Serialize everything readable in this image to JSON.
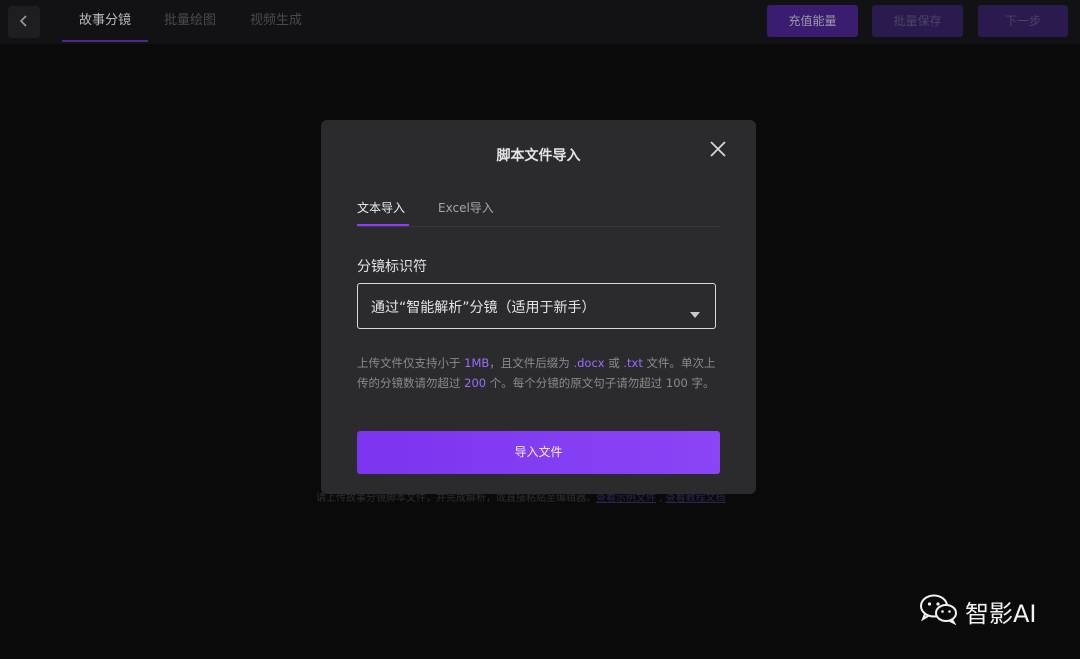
{
  "topbar": {
    "tabs": [
      {
        "label": "故事分镜",
        "active": true
      },
      {
        "label": "批量绘图",
        "active": false
      },
      {
        "label": "视频生成",
        "active": false
      }
    ],
    "buttons": {
      "recharge": "充值能量",
      "middle": "批量保存",
      "next": "下一步"
    }
  },
  "background_hint": {
    "text": "请上传故事分镜脚本文件，并完成解析，或直接粘贴至编辑器。",
    "link1": "查看示例文件",
    "link2": "查看教程文档"
  },
  "modal": {
    "title": "脚本文件导入",
    "tabs": [
      {
        "label": "文本导入",
        "active": true
      },
      {
        "label": "Excel导入",
        "active": false
      }
    ],
    "field_label": "分镜标识符",
    "select_value": "通过“智能解析”分镜（适用于新手）",
    "info": {
      "p1": "上传文件仅支持小于 ",
      "size": "1MB",
      "p2": "，且文件后缀为 ",
      "ext1": ".docx",
      "p3": " 或 ",
      "ext2": ".txt",
      "p4": " 文件。单次上传的分镜数请勿超过 ",
      "count": "200",
      "p5": " 个。每个分镜的原文句子请勿超过 100 字。"
    },
    "import_button": "导入文件"
  },
  "watermark": {
    "text": "智影AI"
  },
  "colors": {
    "accent": "#7c3aed",
    "highlight": "#9b6bff",
    "modal_bg": "#2b2b2e",
    "page_bg": "#0a0a0b"
  },
  "icons": {
    "back": "chevron-left-icon",
    "close": "close-icon",
    "caret": "caret-down-icon",
    "watermark": "wechat-icon"
  }
}
